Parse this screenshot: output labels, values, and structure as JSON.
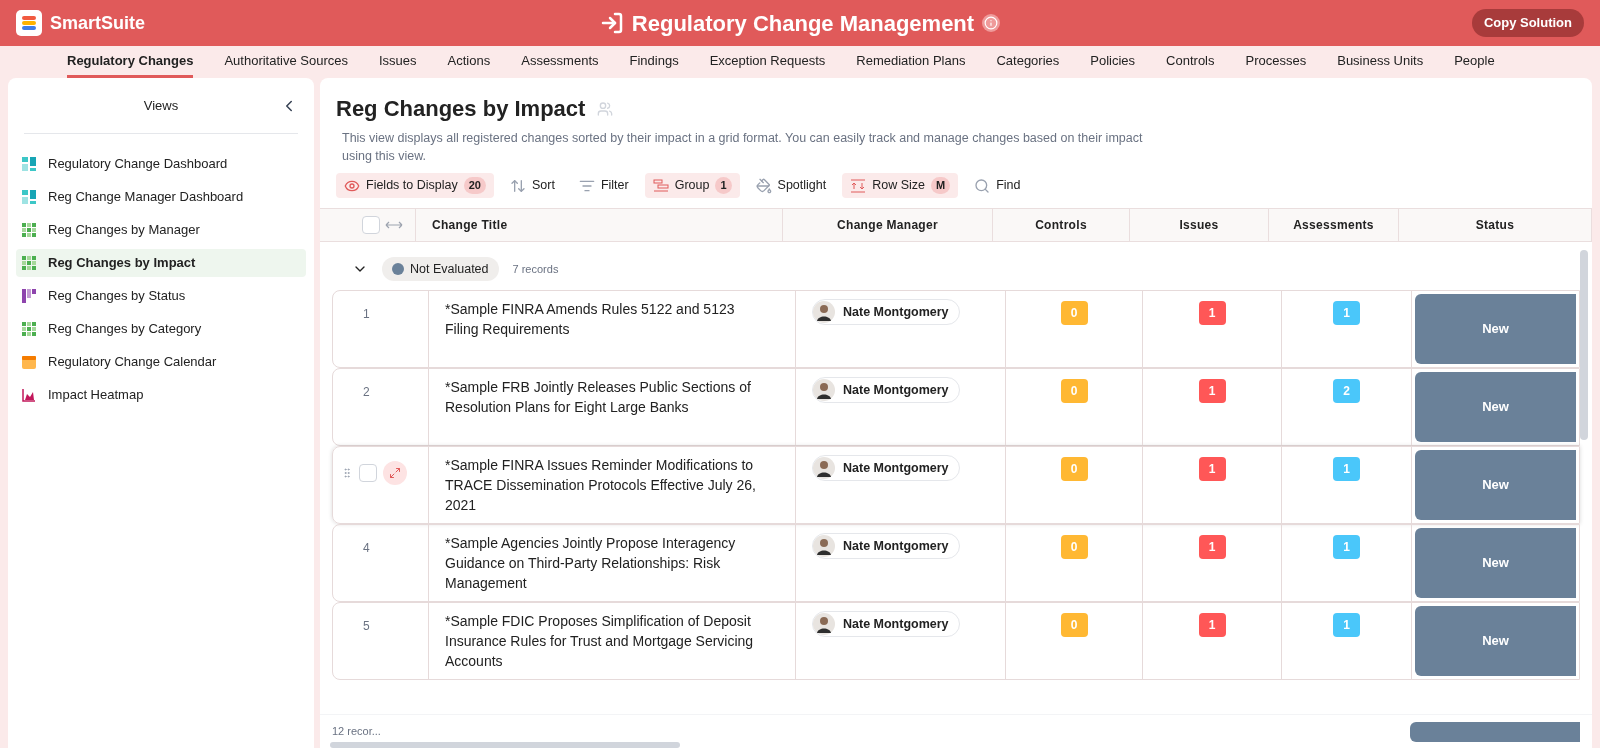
{
  "app": {
    "name": "SmartSuite",
    "title": "Regulatory Change Management",
    "copy_button": "Copy Solution"
  },
  "tabs": [
    {
      "label": "Regulatory Changes",
      "selected": true
    },
    {
      "label": "Authoritative Sources",
      "selected": false
    },
    {
      "label": "Issues",
      "selected": false
    },
    {
      "label": "Actions",
      "selected": false
    },
    {
      "label": "Assessments",
      "selected": false
    },
    {
      "label": "Findings",
      "selected": false
    },
    {
      "label": "Exception Requests",
      "selected": false
    },
    {
      "label": "Remediation Plans",
      "selected": false
    },
    {
      "label": "Categories",
      "selected": false
    },
    {
      "label": "Policies",
      "selected": false
    },
    {
      "label": "Controls",
      "selected": false
    },
    {
      "label": "Processes",
      "selected": false
    },
    {
      "label": "Business Units",
      "selected": false
    },
    {
      "label": "People",
      "selected": false
    }
  ],
  "sidebar": {
    "title": "Views",
    "items": [
      {
        "label": "Regulatory Change Dashboard",
        "kind": "dashboard",
        "selected": false
      },
      {
        "label": "Reg Change Manager Dashboard",
        "kind": "dashboard",
        "selected": false
      },
      {
        "label": "Reg Changes by Manager",
        "kind": "grid",
        "selected": false
      },
      {
        "label": "Reg Changes by Impact",
        "kind": "grid",
        "selected": true
      },
      {
        "label": "Reg Changes by Status",
        "kind": "kanban",
        "selected": false
      },
      {
        "label": "Reg Changes by Category",
        "kind": "grid",
        "selected": false
      },
      {
        "label": "Regulatory Change Calendar",
        "kind": "calendar",
        "selected": false
      },
      {
        "label": "Impact Heatmap",
        "kind": "chart",
        "selected": false
      }
    ]
  },
  "view": {
    "title": "Reg Changes by Impact",
    "description": "This view displays all registered changes sorted by their impact in a grid format. You can easily track and manage changes based on their impact using this view."
  },
  "toolbar": [
    {
      "label": "Fields to Display",
      "kind": "eye",
      "count": "20",
      "active": true
    },
    {
      "label": "Sort",
      "kind": "sort",
      "active": false
    },
    {
      "label": "Filter",
      "kind": "filter",
      "active": false
    },
    {
      "label": "Group",
      "kind": "group",
      "count": "1",
      "active": true
    },
    {
      "label": "Spotlight",
      "kind": "spotlight",
      "active": false
    },
    {
      "label": "Row Size",
      "kind": "rowsize",
      "count": "M",
      "active": true
    },
    {
      "label": "Find",
      "kind": "find",
      "active": false
    }
  ],
  "table": {
    "select_all": {
      "checked": false
    },
    "columns": [
      "Change Title",
      "Change Manager",
      "Controls",
      "Issues",
      "Assessments",
      "Status"
    ],
    "group": {
      "label": "Not Evaluated",
      "color": "#6a8199",
      "count": "7 records",
      "expanded": true
    },
    "rows": [
      {
        "number": "1",
        "hovered": false,
        "title": "*Sample FINRA Amends Rules 5122 and 5123 Filing Requirements",
        "manager": "Nate Montgomery",
        "controls": "0",
        "issues": "1",
        "assessments": "1",
        "status": "New"
      },
      {
        "number": "2",
        "hovered": false,
        "title": "*Sample FRB Jointly Releases Public Sections of Resolution Plans for Eight Large Banks",
        "manager": "Nate Montgomery",
        "controls": "0",
        "issues": "1",
        "assessments": "2",
        "status": "New"
      },
      {
        "hovered": true,
        "title": "*Sample FINRA Issues Reminder Modifications to TRACE Dissemination Protocols Effective July 26, 2021",
        "manager": "Nate Montgomery",
        "controls": "0",
        "issues": "1",
        "assessments": "1",
        "status": "New"
      },
      {
        "number": "4",
        "hovered": false,
        "title": "*Sample Agencies Jointly Propose Interagency Guidance on Third-Party Relationships: Risk Management",
        "manager": "Nate Montgomery",
        "controls": "0",
        "issues": "1",
        "assessments": "1",
        "status": "New"
      },
      {
        "number": "5",
        "hovered": false,
        "title": "*Sample FDIC Proposes Simplification of Deposit Insurance Rules for Trust and Mortgage Servicing Accounts",
        "manager": "Nate Montgomery",
        "controls": "0",
        "issues": "1",
        "assessments": "1",
        "status": "New"
      }
    ],
    "footer": "12 recor..."
  }
}
